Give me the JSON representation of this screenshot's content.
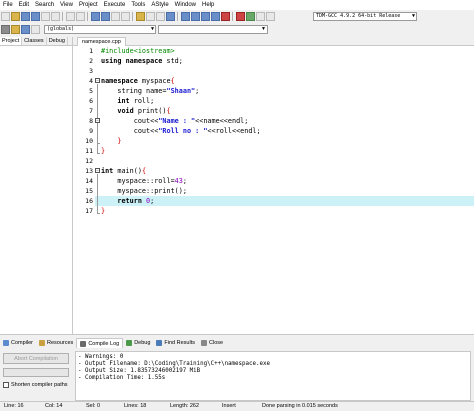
{
  "menu": [
    "File",
    "Edit",
    "Search",
    "View",
    "Project",
    "Execute",
    "Tools",
    "AStyle",
    "Window",
    "Help"
  ],
  "toolbar": {
    "compiler": "TDM-GCC 4.9.2 64-bit Release",
    "scope": "(globals)"
  },
  "left_panel": {
    "tabs": [
      "Project",
      "Classes",
      "Debug"
    ]
  },
  "editor": {
    "tab": "namespace.cpp",
    "lines": [
      "1",
      "2",
      "3",
      "4",
      "5",
      "6",
      "7",
      "8",
      "9",
      "10",
      "11",
      "12",
      "13",
      "14",
      "15",
      "16",
      "17"
    ]
  },
  "code": {
    "l1_pp": "#include<iostream>",
    "l2_kw1": "using",
    "l2_kw2": "namespace",
    "l2_rest": " std;",
    "l4_kw": "namespace",
    "l4_rest": " myspace",
    "l4_brace": "{",
    "l5_a": "string name=",
    "l5_str": "\"Shaan\"",
    "l5_end": ";",
    "l6_kw": "int",
    "l6_rest": " roll;",
    "l7_kw": "void",
    "l7_rest": " print()",
    "l7_brace": "{",
    "l8_a": "cout<<",
    "l8_str": "\"Name : \"",
    "l8_b": "<<name<<endl;",
    "l9_a": "cout<<",
    "l9_str": "\"Roll no : \"",
    "l9_b": "<<roll<<endl;",
    "l10_brace": "}",
    "l11_brace": "}",
    "l13_kw": "int",
    "l13_rest": " main()",
    "l13_brace": "{",
    "l14_a": "myspace::roll=",
    "l14_num": "43",
    "l14_end": ";",
    "l15": "myspace::print();",
    "l16_kw": "return",
    "l16_num": " 0",
    "l16_end": ";",
    "l17_brace": "}"
  },
  "bottom_panel": {
    "tabs": [
      "Compiler",
      "Resources",
      "Compile Log",
      "Debug",
      "Find Results",
      "Close"
    ],
    "abort_label": "Abort Compilation",
    "shorten_label": "Shorten compiler paths",
    "log": [
      "- Warnings: 0",
      "- Output Filename: D:\\Coding\\Training\\C++\\namespace.exe",
      "- Output Size: 1.83573246002197 MiB",
      "- Compilation Time: 1.55s"
    ]
  },
  "status": {
    "line": "Line: 16",
    "col": "Col: 14",
    "sel": "Sel: 0",
    "lines": "Lines: 18",
    "length": "Length: 262",
    "mode": "Insert",
    "message": "Done parsing in 0.015 seconds"
  },
  "colors": {
    "active_line": "#ccf2f7",
    "preprocessor": "#008a00",
    "string": "#1a1ad0",
    "number": "#8a00c0",
    "symbol": "#d00000"
  }
}
